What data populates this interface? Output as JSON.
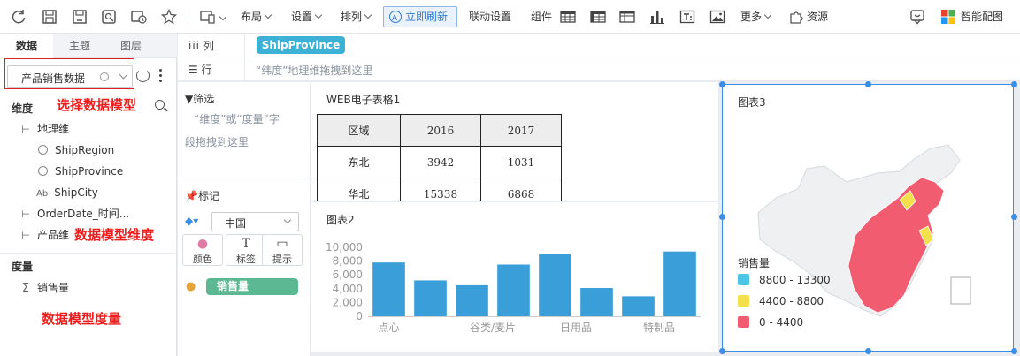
{
  "toolbar": {
    "left_icons": [
      "refresh-icon",
      "save-icon",
      "save-as-icon",
      "preview-icon",
      "publish-icon",
      "favorite-icon"
    ],
    "device_icon": "device-icon",
    "layout": "布局",
    "settings": "设置",
    "arrange": "排列",
    "refresh_now": "立即刷新",
    "linkage": "联动设置",
    "components": "组件",
    "more": "更多",
    "resources": "资源",
    "smart_color": "智能配图"
  },
  "left_panel": {
    "tabs": [
      "数据",
      "主题",
      "图层"
    ],
    "model_select": "产品销售数据",
    "dimension_title": "维度",
    "dimensions": {
      "geo": "地理维",
      "ship_region": "ShipRegion",
      "ship_province": "ShipProvince",
      "ship_city": "ShipCity",
      "order_date": "OrderDate_时间...",
      "product": "产品维"
    },
    "measure_title": "度量",
    "measures": {
      "sales": "销售量"
    },
    "notes": {
      "select_model": "选择数据模型",
      "model_dimension": "数据模型维度",
      "model_measure": "数据模型度量"
    }
  },
  "shelves": {
    "column_label": "列",
    "column_field": "ShipProvince",
    "row_label": "行",
    "row_hint": "“纬度”地理维拖拽到这里"
  },
  "filter": {
    "title": "筛选",
    "hint_line1": "“维度”或“度量”字",
    "hint_line2": "段拖拽到这里"
  },
  "marks": {
    "title": "标记",
    "geo_select": "中国",
    "buttons": {
      "color": "颜色",
      "label": "标签",
      "tooltip": "提示"
    },
    "field": "销售量"
  },
  "table_card": {
    "title": "WEB电子表格1",
    "headers": [
      "区域",
      "2016",
      "2017"
    ],
    "rows": [
      [
        "东北",
        "3942",
        "1031"
      ],
      [
        "华北",
        "15338",
        "6868"
      ]
    ]
  },
  "chart_card": {
    "title": "图表2",
    "colors": {
      "bar": "#3a9fd8"
    }
  },
  "chart_data": {
    "type": "bar",
    "categories": [
      "点心",
      "",
      "谷类/麦片",
      "",
      "日用品",
      "",
      "特制品",
      ""
    ],
    "values": [
      7800,
      5200,
      4500,
      7500,
      9000,
      4100,
      2900,
      9400
    ],
    "title": "图表2",
    "xlabel": "",
    "ylabel": "",
    "ylim": [
      0,
      10000
    ],
    "yticks": [
      "0",
      "2,000",
      "4,000",
      "6,000",
      "8,000",
      "10,000"
    ],
    "grid": false
  },
  "map_card": {
    "title": "图表3",
    "legend_title": "销售量",
    "legend": [
      {
        "label": "8800 - 13300",
        "color": "#4cc6e6"
      },
      {
        "label": "4400 - 8800",
        "color": "#f4e04a"
      },
      {
        "label": "0 - 4400",
        "color": "#f25c70"
      }
    ],
    "base_color": "#eef0f2"
  }
}
